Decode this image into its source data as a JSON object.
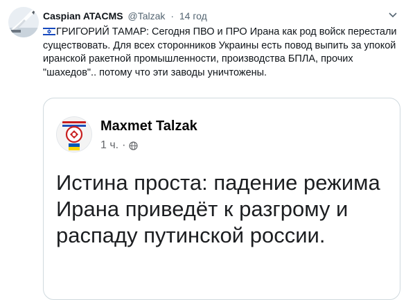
{
  "tweet": {
    "author_name": "Caspian ATACMS",
    "handle": "@Talzak",
    "separator": "·",
    "time": "14 год",
    "text": "ГРИГОРИЙ ТАМАР: Сегодня ПВО и ПРО Ирана как род войск перестали существовать. Для всех сторонников Украины есть повод выпить за упокой иранской ракетной промышленности,  производства БПЛА,  прочих \"шахедов\".. потому что эти заводы уничтожены.",
    "avatar_icon": "missile-launch-icon",
    "flag_icon": "israel-flag-icon"
  },
  "quote": {
    "author_name": "Maxmet Talzak",
    "time": "1 ч.",
    "separator": "·",
    "privacy_icon": "globe-icon",
    "text": "Истина проста: падение режима Ирана приведёт к разгрому и распаду путинской россии."
  },
  "colors": {
    "text_primary": "#0f1419",
    "text_secondary": "#536471",
    "border": "#cfd9de",
    "israel_blue": "#0038b8",
    "ukraine_blue": "#0057b7",
    "ukraine_yellow": "#ffd700"
  }
}
